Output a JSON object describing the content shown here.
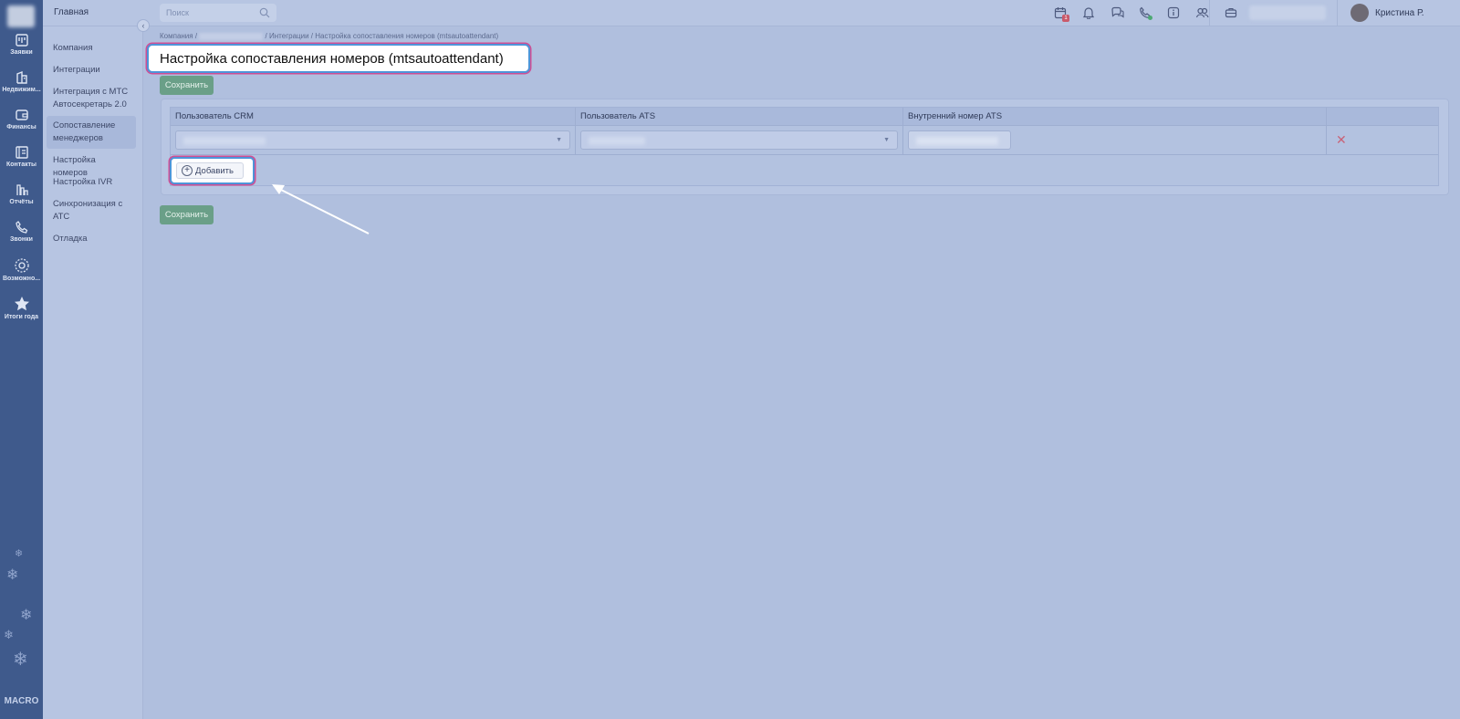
{
  "rail": {
    "items": [
      {
        "label": "Заявки",
        "icon": "requests-icon"
      },
      {
        "label": "Недвижим...",
        "icon": "building-icon"
      },
      {
        "label": "Финансы",
        "icon": "wallet-icon"
      },
      {
        "label": "Контакты",
        "icon": "contacts-icon"
      },
      {
        "label": "Отчёты",
        "icon": "reports-icon"
      },
      {
        "label": "Звонки",
        "icon": "phone-icon"
      },
      {
        "label": "Возможно...",
        "icon": "gear-icon"
      },
      {
        "label": "Итоги года",
        "icon": "star-icon"
      }
    ],
    "brand": "MACRO"
  },
  "header": {
    "home": "Главная",
    "search_placeholder": "Поиск",
    "calendar_badge": "1",
    "user_name": "Кристина Р."
  },
  "submenu": {
    "items": [
      {
        "label": "Компания",
        "active": false
      },
      {
        "label": "Интеграции",
        "active": false
      },
      {
        "label": "Интеграция с МТС Автосекретарь 2.0",
        "active": false
      },
      {
        "label": "Сопоставление менеджеров",
        "active": true
      },
      {
        "label": "Настройка номеров",
        "active": false
      },
      {
        "label": "Настройка IVR",
        "active": false
      },
      {
        "label": "Синхронизация с АТС",
        "active": false
      },
      {
        "label": "Отладка",
        "active": false
      }
    ]
  },
  "breadcrumb": {
    "first": "Компания",
    "sep": "/",
    "third": "Интеграции",
    "current": "Настройка сопоставления номеров (mtsautoattendant)"
  },
  "page": {
    "title": "Настройка сопоставления номеров (mtsautoattendant)",
    "save_label": "Сохранить",
    "add_label": "Добавить"
  },
  "table": {
    "columns": [
      "Пользователь CRM",
      "Пользователь ATS",
      "Внутренний номер ATS"
    ],
    "delete_glyph": "✕"
  },
  "colors": {
    "rail_bg": "#3f5a8c",
    "page_bg": "#b0bfde",
    "save_button": "#6a9f88",
    "highlight_blue": "#4e95d9",
    "highlight_pink": "#cf4f94",
    "delete_red": "#c86378"
  }
}
